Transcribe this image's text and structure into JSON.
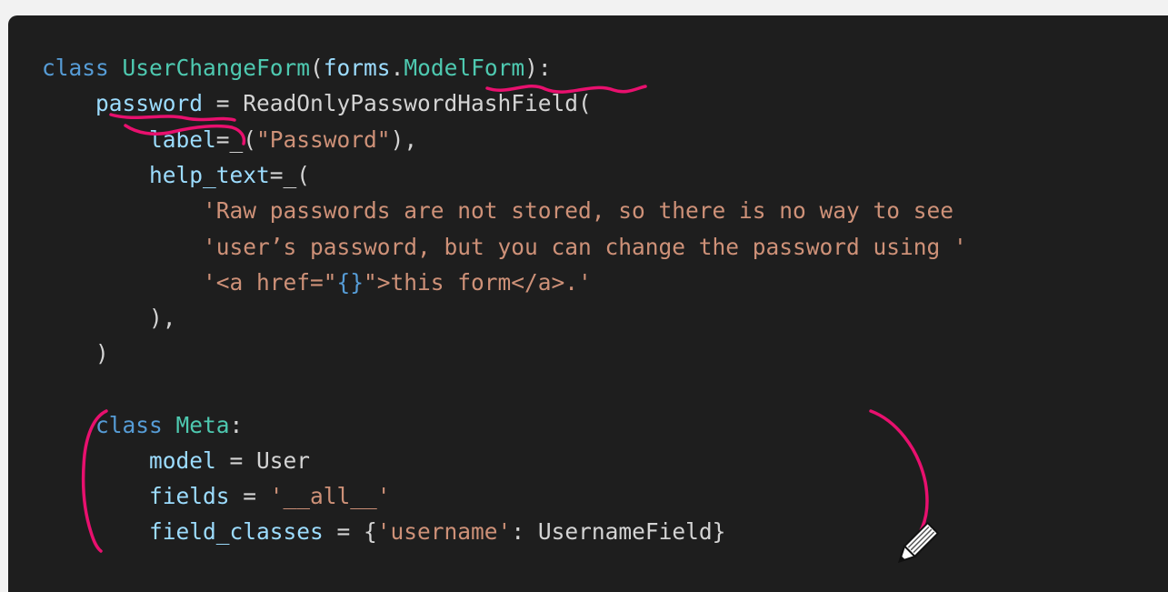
{
  "editor": {
    "theme": "dark",
    "colors": {
      "background": "#1e1e1e",
      "keyword": "#569cd6",
      "class_name": "#4ec9b0",
      "variable": "#9cdcfe",
      "string": "#ce9178",
      "plain": "#d4d4d4",
      "annotation": "#e8106e"
    },
    "lines": [
      {
        "tokens": [
          {
            "text": "class ",
            "kind": "kw"
          },
          {
            "text": "UserChangeForm",
            "kind": "cls"
          },
          {
            "text": "(",
            "kind": "pl"
          },
          {
            "text": "forms",
            "kind": "var"
          },
          {
            "text": ".",
            "kind": "pl"
          },
          {
            "text": "ModelForm",
            "kind": "cls"
          },
          {
            "text": "):",
            "kind": "pl"
          }
        ]
      },
      {
        "tokens": [
          {
            "text": "    ",
            "kind": "pl"
          },
          {
            "text": "password",
            "kind": "var"
          },
          {
            "text": " = ReadOnlyPasswordHashField(",
            "kind": "pl"
          }
        ]
      },
      {
        "tokens": [
          {
            "text": "        ",
            "kind": "pl"
          },
          {
            "text": "label",
            "kind": "var"
          },
          {
            "text": "=_(",
            "kind": "pl"
          },
          {
            "text": "\"Password\"",
            "kind": "str"
          },
          {
            "text": "),",
            "kind": "pl"
          }
        ]
      },
      {
        "tokens": [
          {
            "text": "        ",
            "kind": "pl"
          },
          {
            "text": "help_text",
            "kind": "var"
          },
          {
            "text": "=_(",
            "kind": "pl"
          }
        ]
      },
      {
        "tokens": [
          {
            "text": "            ",
            "kind": "pl"
          },
          {
            "text": "'Raw passwords are not stored, so there is no way to see",
            "kind": "str"
          }
        ]
      },
      {
        "tokens": [
          {
            "text": "            ",
            "kind": "pl"
          },
          {
            "text": "'user’s password, but you can change the password using '",
            "kind": "str"
          }
        ]
      },
      {
        "tokens": [
          {
            "text": "            ",
            "kind": "pl"
          },
          {
            "text": "'<a href=\"",
            "kind": "str"
          },
          {
            "text": "{}",
            "kind": "kw"
          },
          {
            "text": "\">this form</a>.'",
            "kind": "str"
          }
        ]
      },
      {
        "tokens": [
          {
            "text": "        ),",
            "kind": "pl"
          }
        ]
      },
      {
        "tokens": [
          {
            "text": "    )",
            "kind": "pl"
          }
        ]
      },
      {
        "tokens": []
      },
      {
        "tokens": [
          {
            "text": "    ",
            "kind": "pl"
          },
          {
            "text": "class ",
            "kind": "kw"
          },
          {
            "text": "Meta",
            "kind": "cls"
          },
          {
            "text": ":",
            "kind": "pl"
          }
        ]
      },
      {
        "tokens": [
          {
            "text": "        ",
            "kind": "pl"
          },
          {
            "text": "model",
            "kind": "var"
          },
          {
            "text": " = User",
            "kind": "pl"
          }
        ]
      },
      {
        "tokens": [
          {
            "text": "        ",
            "kind": "pl"
          },
          {
            "text": "fields",
            "kind": "var"
          },
          {
            "text": " = ",
            "kind": "pl"
          },
          {
            "text": "'__all__'",
            "kind": "str"
          }
        ]
      },
      {
        "tokens": [
          {
            "text": "        ",
            "kind": "pl"
          },
          {
            "text": "field_classes",
            "kind": "var"
          },
          {
            "text": " = {",
            "kind": "pl"
          },
          {
            "text": "'username'",
            "kind": "str"
          },
          {
            "text": ": UsernameField}",
            "kind": "pl"
          }
        ]
      }
    ]
  },
  "annotations": {
    "color": "#e8106e",
    "cursor_icon": "pencil-icon"
  }
}
